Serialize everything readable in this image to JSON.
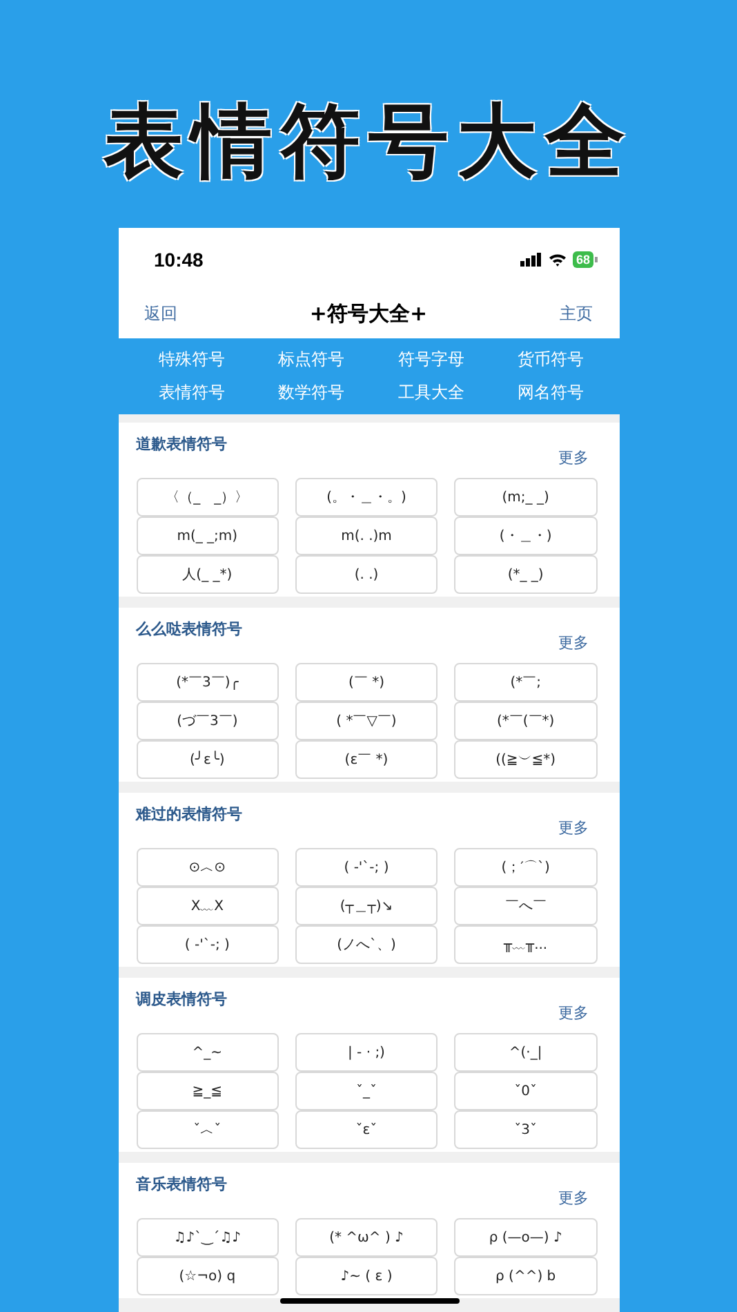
{
  "banner_title": "表情符号大全",
  "status_bar": {
    "time": "10:48",
    "battery": "68"
  },
  "nav": {
    "back": "返回",
    "title": "+符号大全+",
    "home": "主页"
  },
  "categories": [
    "特殊符号",
    "标点符号",
    "符号字母",
    "货币符号",
    "表情符号",
    "数学符号",
    "工具大全",
    "网名符号"
  ],
  "sections": [
    {
      "title": "道歉表情符号",
      "more": "更多",
      "items": [
        "〈（_　_）〉",
        "(。・＿・。)",
        "(m;_ _)",
        "m(_ _;m)",
        "m(. .)m",
        "(・＿・)",
        "人(_ _*)",
        "(. .)",
        "(*_ _)"
      ]
    },
    {
      "title": "么么哒表情符号",
      "more": "更多",
      "items": [
        "(*￣3￣)╭",
        "(￣ *)",
        "(*￣;",
        "(づ￣3￣)",
        "( *￣▽￣)",
        "(*￣(￣*)",
        "(╯ε╰)",
        "(ε￣ *)",
        "((≧︶≦*)"
      ]
    },
    {
      "title": "难过的表情符号",
      "more": "更多",
      "items": [
        "⊙︿⊙",
        "( -'`-; )",
        "(；′⌒`)",
        "X﹏X",
        "(┬＿┬)↘",
        "￣へ￣",
        "( -'`-; )",
        "(ノへ`、)",
        "╥﹏╥..."
      ]
    },
    {
      "title": "调皮表情符号",
      "more": "更多",
      "items": [
        "^_~",
        "| - · ;)",
        "^(·_|",
        "≧_≦",
        "ˇ_ˇ",
        "ˇ0ˇ",
        "ˇ︿ˇ",
        "ˇεˇ",
        "ˇ3ˇ"
      ]
    },
    {
      "title": "音乐表情符号",
      "more": "更多",
      "items": [
        "♫♪`‿´♫♪",
        "(*  ^ω^ ) ♪",
        "ρ (—o—) ♪",
        "(☆¬o) q",
        "♪~ (  ε  )",
        "ρ (^^)  b"
      ]
    }
  ]
}
